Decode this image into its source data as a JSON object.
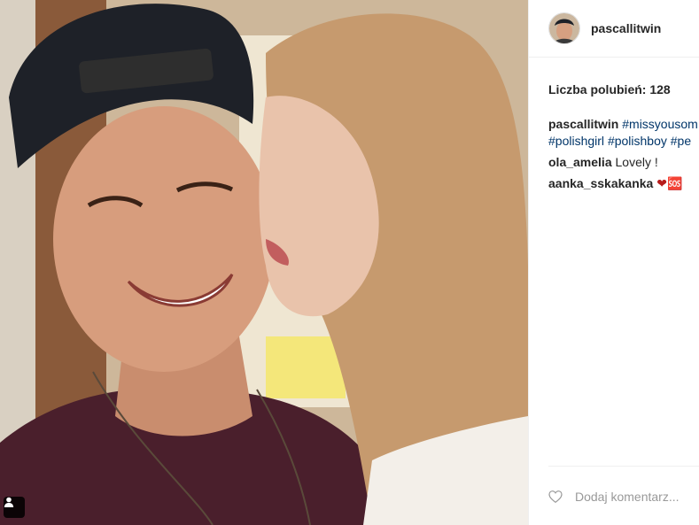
{
  "post": {
    "username": "pascallitwin",
    "likes_text": "Liczba polubień: 128",
    "caption": {
      "author": "pascallitwin",
      "line1_tag": "#missyousom",
      "line2_tags": [
        "#polishgirl",
        "#polishboy",
        "#pe"
      ]
    },
    "comments": [
      {
        "author": "ola_amelia",
        "text": "Lovely !"
      },
      {
        "author": "aanka_sskakanka",
        "text": "❤🆘"
      }
    ],
    "add_comment_placeholder": "Dodaj komentarz..."
  },
  "colors": {
    "hashtag": "#003569",
    "heart": "#b71c1c",
    "text": "#262626"
  },
  "icons": {
    "tag_badge": "person-icon",
    "like": "heart-outline-icon"
  }
}
